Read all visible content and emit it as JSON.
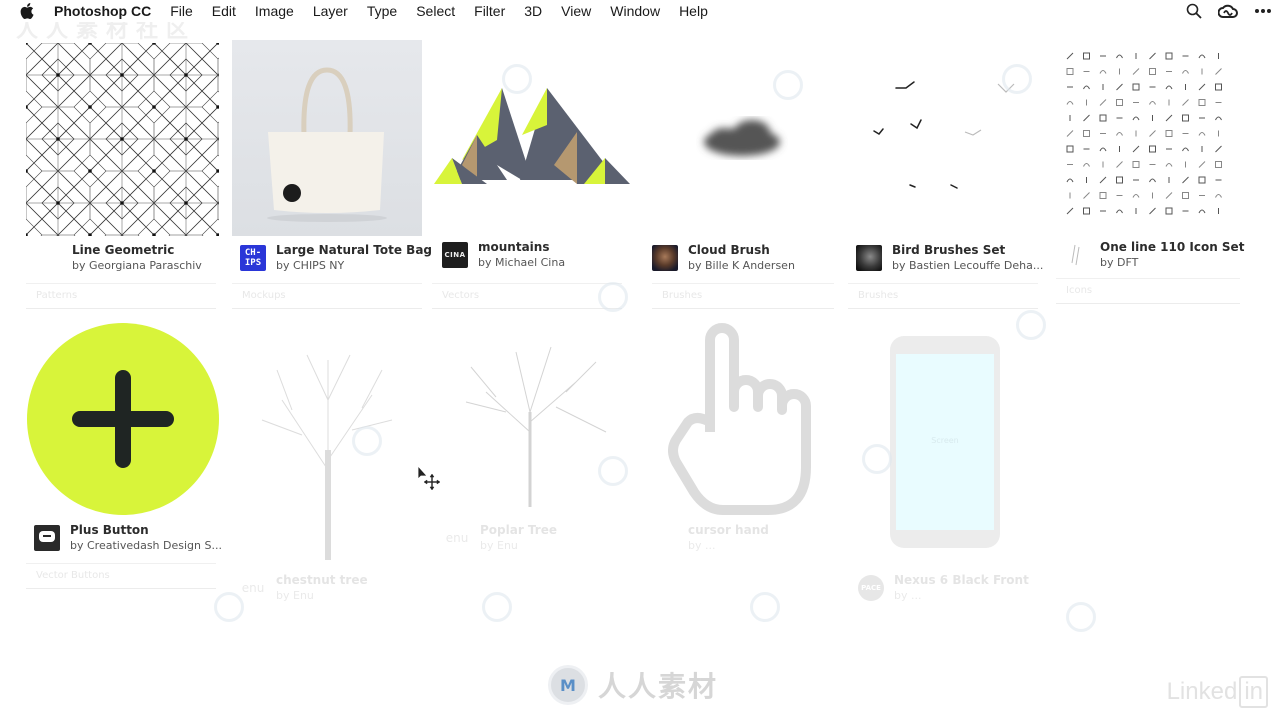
{
  "menubar": {
    "app_name": "Photoshop CC",
    "menus": [
      "File",
      "Edit",
      "Image",
      "Layer",
      "Type",
      "Select",
      "Filter",
      "3D",
      "View",
      "Window",
      "Help"
    ],
    "right_icons": [
      "search-icon",
      "creative-cloud-icon",
      "more-icon"
    ]
  },
  "library": {
    "items": [
      {
        "title": "Line Geometric",
        "author": "by Georgiana Paraschiv",
        "category": "Patterns",
        "avatar": "none",
        "state": "active"
      },
      {
        "title": "Large Natural Tote Bag",
        "author": "by CHIPS NY",
        "category": "Mockups",
        "avatar": "CH-\nIPS",
        "state": "active"
      },
      {
        "title": "mountains",
        "author": "by Michael Cina",
        "category": "Vectors",
        "avatar": "CINA",
        "state": "active"
      },
      {
        "title": "Cloud Brush",
        "author": "by Bille K Andersen",
        "category": "Brushes",
        "avatar": "photo",
        "state": "active"
      },
      {
        "title": "Bird Brushes Set",
        "author": "by Bastien Lecouffe Deha...",
        "category": "Brushes",
        "avatar": "photo",
        "state": "active"
      },
      {
        "title": "One line 110 Icon Set",
        "author": "by DFT",
        "category": "Icons",
        "avatar": "sketch",
        "state": "active"
      },
      {
        "title": "Plus Button",
        "author": "by Creativedash Design S...",
        "category": "Vector Buttons",
        "avatar": "dash",
        "state": "active"
      },
      {
        "title": "chestnut tree",
        "author": "by Enu",
        "category": "",
        "avatar": "enu",
        "state": "faded"
      },
      {
        "title": "Poplar Tree",
        "author": "by Enu",
        "category": "",
        "avatar": "enu",
        "state": "faded"
      },
      {
        "title": "cursor hand",
        "author": "by ...",
        "category": "",
        "avatar": "none",
        "state": "faded"
      },
      {
        "title": "Nexus 6 Black Front",
        "author": "by ...",
        "category": "",
        "avatar": "pace",
        "state": "faded"
      }
    ],
    "phone_screen_label": "Screen"
  },
  "watermarks": {
    "brand_cn": "人人素材",
    "brand_top_cn": "人人素材社区",
    "linkedin_text": "Linked",
    "linkedin_in": "in"
  },
  "colors": {
    "accent_lime": "#d8f43a",
    "slate": "#5b6170",
    "tan": "#b59870",
    "chips_blue": "#2a36d8"
  }
}
